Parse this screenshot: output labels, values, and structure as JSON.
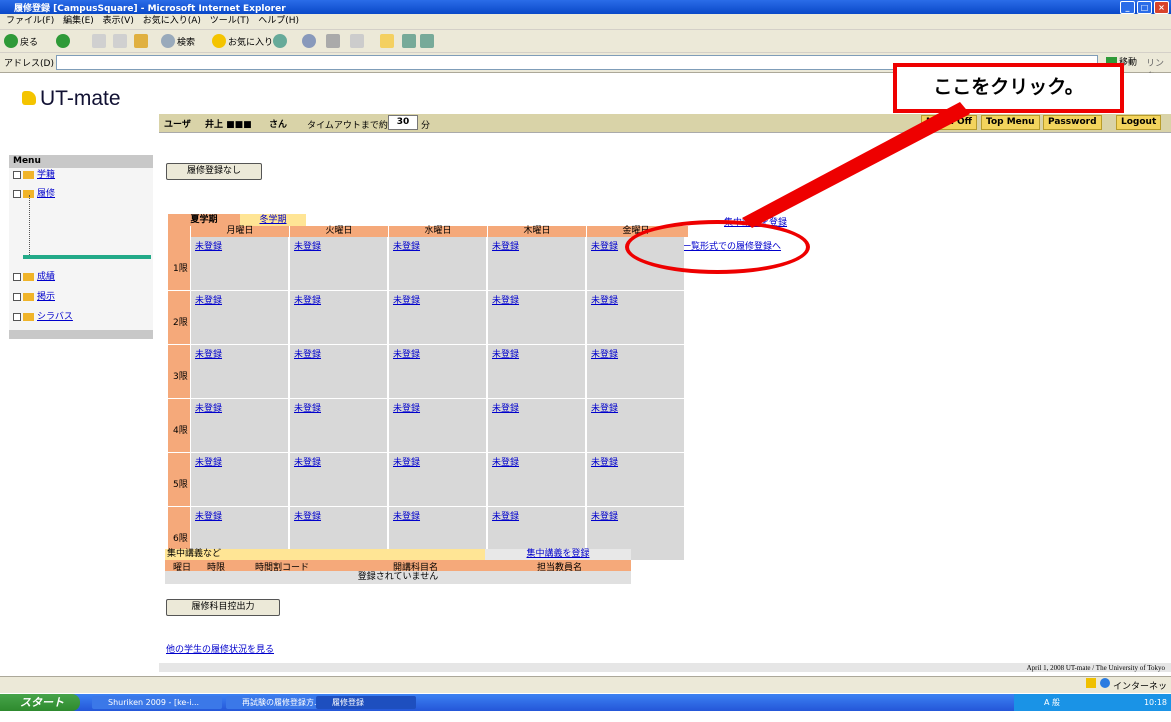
{
  "window": {
    "title": "履修登録 [CampusSquare] - Microsoft Internet Explorer"
  },
  "menubar": [
    "ファイル(F)",
    "編集(E)",
    "表示(V)",
    "お気に入り(A)",
    "ツール(T)",
    "ヘルプ(H)"
  ],
  "toolbar": {
    "back": "戻る",
    "search": "検索",
    "favorites": "お気に入り"
  },
  "addressbar": {
    "label": "アドレス(D)",
    "go": "移動",
    "links": "リンク"
  },
  "app": {
    "logo": "UT-mate"
  },
  "header": {
    "user_label": "ユーザ",
    "user_name": "井上 ■■■",
    "user_suffix": "さん",
    "timeout_label": "タイムアウトまで約",
    "timeout_value": "30",
    "timeout_unit": "分",
    "buttons": {
      "menu_off": "Menu Off",
      "top_menu": "Top Menu",
      "password": "Password",
      "logout": "Logout"
    }
  },
  "annotation": {
    "callout": "ここをクリック。"
  },
  "sidebar": {
    "title": "Menu",
    "items": [
      "学籍",
      "履修",
      "成績",
      "掲示",
      "シラバス"
    ]
  },
  "main": {
    "no_registration_button": "履修登録なし",
    "list_register_link": "一覧形式での履修登録へ",
    "intensive_register_link": "集中講義を登録",
    "tabs": {
      "summer": "夏学期",
      "winter": "冬学期"
    },
    "days": [
      "月曜日",
      "火曜日",
      "水曜日",
      "木曜日",
      "金曜日"
    ],
    "periods": [
      "1限",
      "2限",
      "3限",
      "4限",
      "5限",
      "6限"
    ],
    "cell_text": "未登録",
    "intensive": {
      "title": "集中講義など",
      "register_link": "集中講義を登録",
      "columns": [
        "曜日",
        "時限",
        "時間割コード",
        "開講科目名",
        "担当教員名"
      ],
      "empty": "登録されていません"
    },
    "export_button": "履修科目控出力",
    "other_students_link": "他の学生の履修状況を見る"
  },
  "footer": {
    "text": "April 1, 2008 UT-mate / The University of Tokyo"
  },
  "statusbar": {
    "zone": "インターネット"
  },
  "taskbar": {
    "start": "スタート",
    "tasks": [
      "Shuriken 2009 - [ke-i...",
      "再試験の履修登録方...",
      "履修登録 [CampusSq..."
    ],
    "ime": "A 般",
    "clock": "10:18"
  }
}
